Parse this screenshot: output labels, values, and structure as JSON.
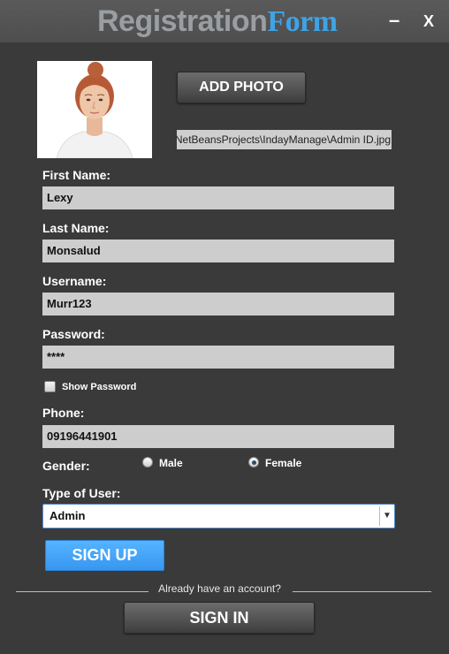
{
  "window": {
    "title_part1": "Registration",
    "title_part2": "Form",
    "minimize_label": "–",
    "close_label": "X"
  },
  "photo": {
    "add_photo_label": "ADD PHOTO",
    "path": "C:\\Users\\NetBeansProjects\\IndayManage\\Admin ID.jpg"
  },
  "form": {
    "first_name_label": "First Name:",
    "first_name_value": "Lexy",
    "last_name_label": "Last Name:",
    "last_name_value": "Monsalud",
    "username_label": "Username:",
    "username_value": "Murr123",
    "password_label": "Password:",
    "password_value": "****",
    "show_password_label": "Show Password",
    "phone_label": "Phone:",
    "phone_value": "09196441901",
    "gender_label": "Gender:",
    "gender_male": "Male",
    "gender_female": "Female",
    "user_type_label": "Type of User:",
    "user_type_value": "Admin"
  },
  "actions": {
    "sign_up_label": "SIGN UP",
    "already_account": "Already have an account?",
    "sign_in_label": "SIGN IN"
  },
  "colors": {
    "background": "#3a3a3a",
    "accent_blue": "#3fa3e6",
    "field_gray": "#cdcdcd"
  }
}
